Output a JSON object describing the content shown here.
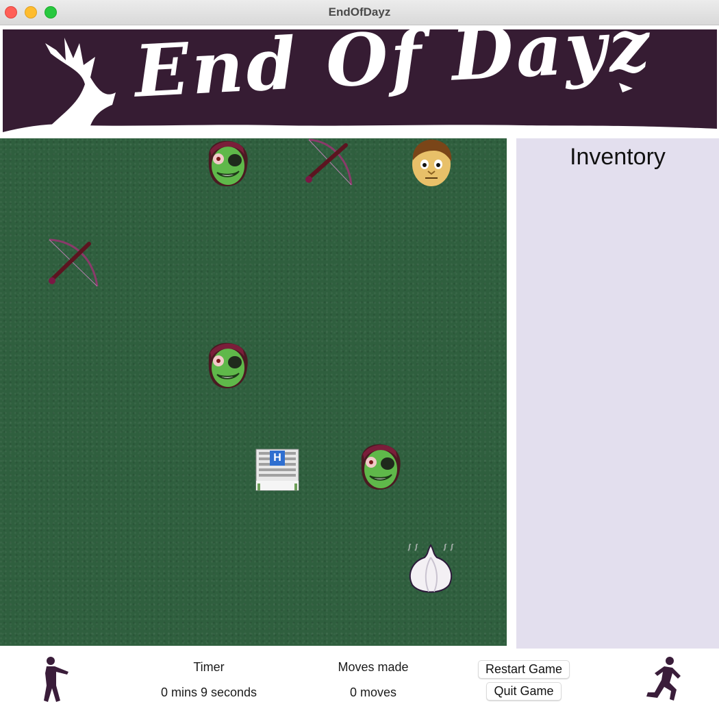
{
  "window": {
    "title": "EndOfDayz"
  },
  "banner": {
    "logo_text": "End Of Dayz"
  },
  "board": {
    "pieces": [
      {
        "type": "zombie",
        "icon": "zombie-icon"
      },
      {
        "type": "crossbow",
        "icon": "crossbow-icon"
      },
      {
        "type": "player",
        "icon": "player-icon"
      },
      {
        "type": "crossbow",
        "icon": "crossbow-icon"
      },
      {
        "type": "zombie",
        "icon": "zombie-icon"
      },
      {
        "type": "hospital",
        "icon": "hospital-icon"
      },
      {
        "type": "zombie",
        "icon": "zombie-icon"
      },
      {
        "type": "garlic",
        "icon": "garlic-icon"
      }
    ],
    "hospital_letter": "H"
  },
  "inventory": {
    "title": "Inventory"
  },
  "status": {
    "timer_label": "Timer",
    "timer_value": "0 mins 9 seconds",
    "moves_label": "Moves made",
    "moves_value": "0 moves"
  },
  "buttons": {
    "restart_label": "Restart Game",
    "quit_label": "Quit Game"
  },
  "colors": {
    "banner_bg": "#361c33",
    "board_bg": "#2f5f3e",
    "inventory_bg": "#e3dfee"
  }
}
